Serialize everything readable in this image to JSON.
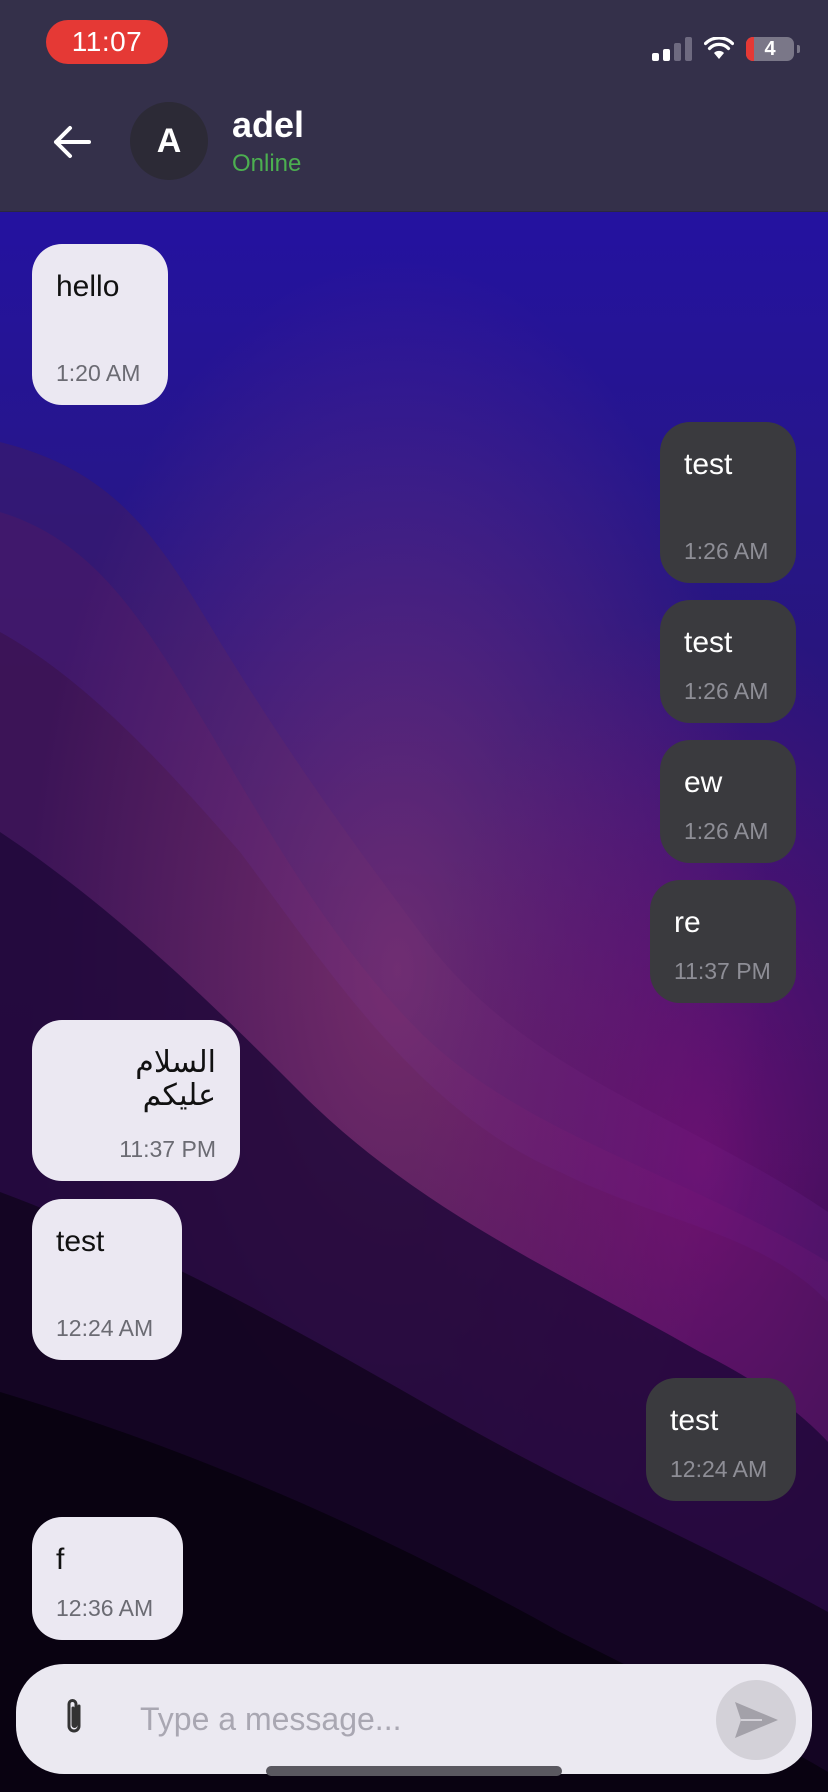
{
  "status_bar": {
    "time": "11:07",
    "battery": "4"
  },
  "header": {
    "avatar_initial": "A",
    "contact_name": "adel",
    "contact_status": "Online"
  },
  "messages": [
    {
      "direction": "in",
      "text": "hello",
      "time": "1:20 AM"
    },
    {
      "direction": "out",
      "text": "test",
      "time": "1:26 AM"
    },
    {
      "direction": "out",
      "text": "test",
      "time": "1:26 AM"
    },
    {
      "direction": "out",
      "text": "ew",
      "time": "1:26 AM"
    },
    {
      "direction": "out",
      "text": "re",
      "time": "11:37 PM"
    },
    {
      "direction": "in",
      "text": "السلام عليكم",
      "time": "11:37 PM"
    },
    {
      "direction": "in",
      "text": "test",
      "time": "12:24 AM"
    },
    {
      "direction": "out",
      "text": "test",
      "time": "12:24 AM"
    },
    {
      "direction": "in",
      "text": "f",
      "time": "12:36 AM"
    }
  ],
  "composer": {
    "placeholder": "Type a message...",
    "value": ""
  },
  "colors": {
    "incoming_bubble": "#ebe8f2",
    "outgoing_bubble": "#3a3a3e",
    "online": "#4caf50",
    "header": "#34304a",
    "time_pill": "#e53935"
  },
  "icons": {
    "back": "arrow-left-icon",
    "attach": "paperclip-icon",
    "send": "send-icon",
    "signal": "cellular-signal-icon",
    "wifi": "wifi-icon",
    "battery": "battery-icon"
  }
}
